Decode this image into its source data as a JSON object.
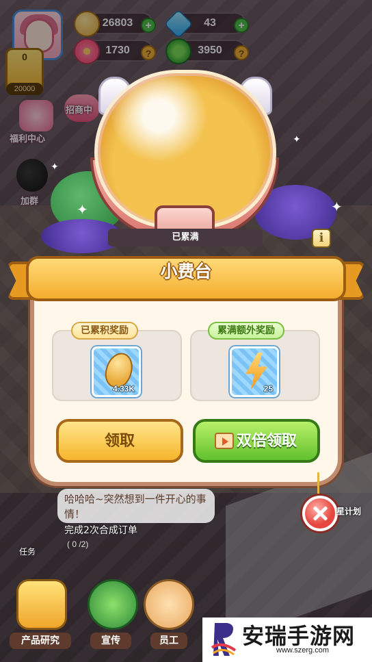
{
  "hud": {
    "seeds": "26803",
    "gems": "43",
    "flowers": "1730",
    "clovers": "3950",
    "level": "0",
    "level_cap": "20000"
  },
  "side": {
    "welfare": "福利中心",
    "recruit": "招商中",
    "join_group": "加群"
  },
  "jar": {
    "status": "已累满",
    "info": "i"
  },
  "dialog": {
    "title": "小费台",
    "accumulated_label": "已累积奖励",
    "accumulated_value": "4.33K",
    "bonus_label": "累满额外奖励",
    "bonus_value": "25",
    "claim_button": "领取",
    "double_claim_button": "双倍领取"
  },
  "background": {
    "chat_text": "哈哈哈~突然想到一件开心的事情！",
    "task_text": "完成2次合成订单",
    "task_progress": "( 0 /2)",
    "task_label": "任务",
    "plan_label": "星计划"
  },
  "bottom_nav": {
    "research": "产品研究",
    "promote": "宣传",
    "staff": "员工"
  },
  "watermark": {
    "name": "安瑞手游网",
    "url": "www.szerg.com"
  },
  "colors": {
    "ribbon": "#f4ae2e",
    "panel": "#fff7ea",
    "claim": "#f6b52c",
    "double_claim": "#62c12e",
    "close": "#e6463e"
  }
}
